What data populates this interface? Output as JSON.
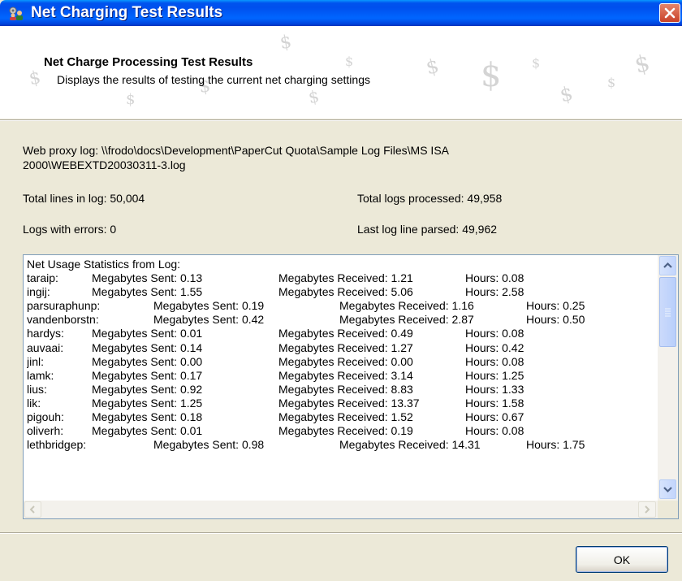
{
  "window": {
    "title": "Net Charging Test Results",
    "app_icon": "gear-users-icon",
    "close_icon": "close-icon"
  },
  "banner": {
    "title": "Net Charge Processing Test Results",
    "subtitle": "Displays the results of testing the current net charging settings",
    "watermark_glyph": "$"
  },
  "info": {
    "web_proxy_log_line1": "Web proxy log:  \\\\frodo\\docs\\Development\\PaperCut Quota\\Sample Log Files\\MS ISA",
    "web_proxy_log_line2": "2000\\WEBEXTD20030311-3.log",
    "total_lines": "Total lines in log:  50,004",
    "total_logs_processed": "Total logs processed:  49,958",
    "logs_with_errors": "Logs with errors:  0",
    "last_log_line": "Last log line parsed:  49,962"
  },
  "log": {
    "header": "Net Usage Statistics from Log:",
    "rows": [
      {
        "user": "taraip:",
        "sent": "Megabytes Sent:  0.13",
        "received": "Megabytes Received:  1.21",
        "hours": "Hours: 0.08"
      },
      {
        "user": "ingij:",
        "sent": "Megabytes Sent:  1.55",
        "received": "Megabytes Received:  5.06",
        "hours": "Hours: 2.58"
      },
      {
        "user": "parsuraphunp:",
        "sent": "Megabytes Sent:  0.19",
        "received": "Megabytes Received:  1.16",
        "hours": "Hours: 0.25"
      },
      {
        "user": "vandenborstn:",
        "sent": "Megabytes Sent:  0.42",
        "received": "Megabytes Received:  2.87",
        "hours": "Hours: 0.50"
      },
      {
        "user": "hardys:",
        "sent": "Megabytes Sent:  0.01",
        "received": "Megabytes Received:  0.49",
        "hours": "Hours: 0.08"
      },
      {
        "user": "auvaai:",
        "sent": "Megabytes Sent:  0.14",
        "received": "Megabytes Received:  1.27",
        "hours": "Hours: 0.42"
      },
      {
        "user": "jinl:",
        "sent": "Megabytes Sent:  0.00",
        "received": "Megabytes Received:  0.00",
        "hours": "Hours: 0.08"
      },
      {
        "user": "lamk:",
        "sent": "Megabytes Sent:  0.17",
        "received": "Megabytes Received:  3.14",
        "hours": "Hours: 1.25"
      },
      {
        "user": "lius:",
        "sent": "Megabytes Sent:  0.92",
        "received": "Megabytes Received:  8.83",
        "hours": "Hours: 1.33"
      },
      {
        "user": "lik:",
        "sent": "Megabytes Sent:  1.25",
        "received": "Megabytes Received:  13.37",
        "hours": "Hours: 1.58"
      },
      {
        "user": "pigouh:",
        "sent": "Megabytes Sent:  0.18",
        "received": "Megabytes Received:  1.52",
        "hours": "Hours: 0.67"
      },
      {
        "user": "oliverh:",
        "sent": "Megabytes Sent:  0.01",
        "received": "Megabytes Received:  0.19",
        "hours": "Hours: 0.08"
      },
      {
        "user": "lethbridgep:",
        "sent": "Megabytes Sent:  0.98",
        "received": "Megabytes Received:  14.31",
        "hours": "Hours: 1.75"
      }
    ]
  },
  "buttons": {
    "ok_label": "OK"
  }
}
